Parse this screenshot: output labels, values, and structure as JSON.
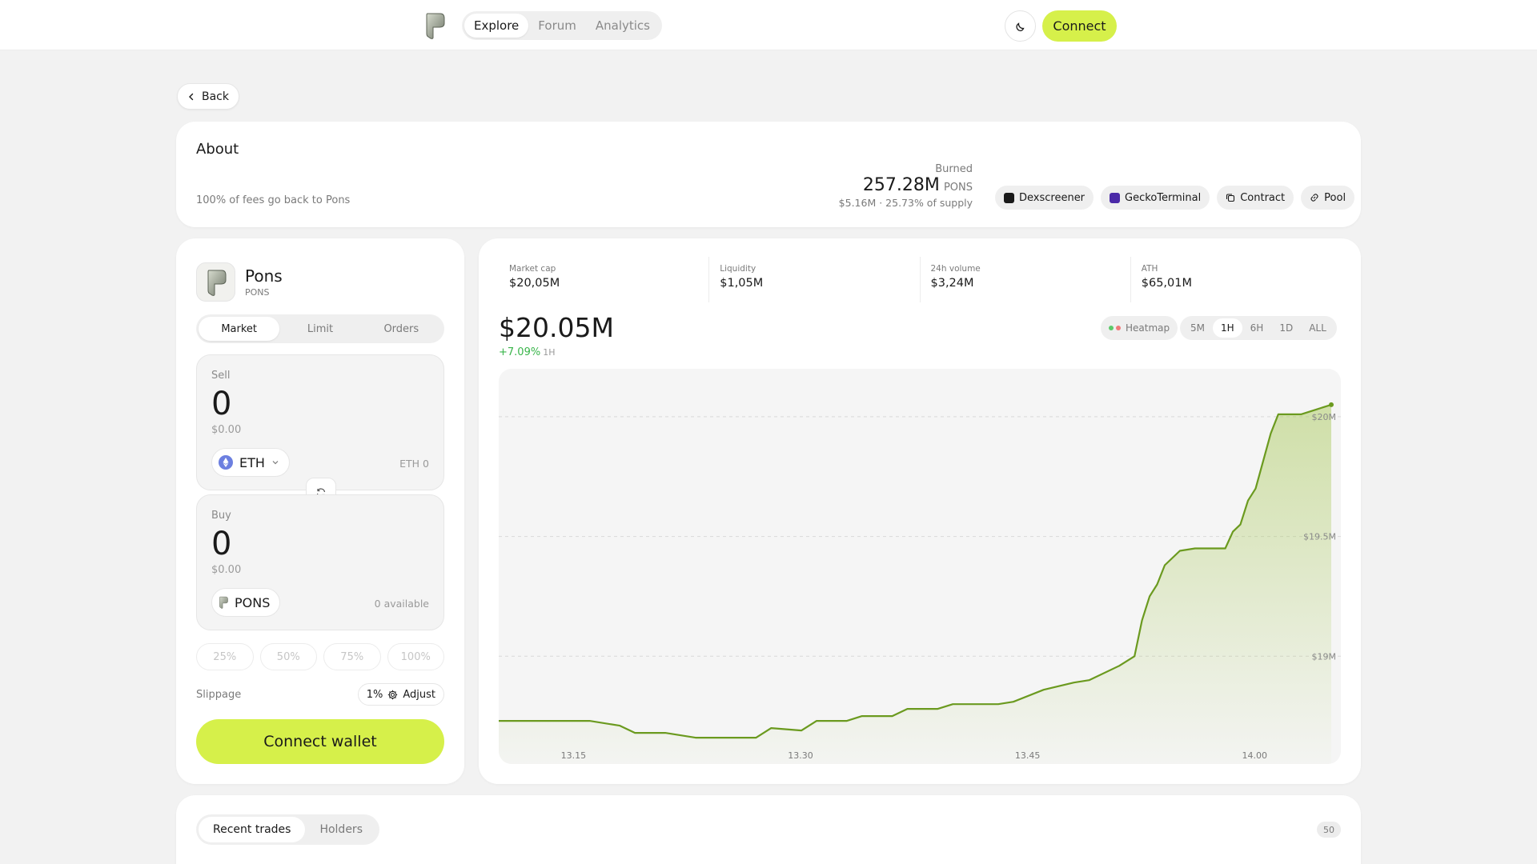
{
  "nav": {
    "tabs": [
      "Explore",
      "Forum",
      "Analytics"
    ],
    "connect_label": "Connect",
    "theme_icon": "moon-icon"
  },
  "back_label": "Back",
  "about": {
    "title": "About",
    "description": "100% of fees go back to Pons",
    "burned_label": "Burned",
    "burned_amount": "257.28M",
    "burned_unit": "PONS",
    "burned_sub": "$5.16M · 25.73% of supply",
    "links": [
      "Dexscreener",
      "GeckoTerminal",
      "Contract",
      "Pool"
    ]
  },
  "token": {
    "name": "Pons",
    "symbol": "PONS"
  },
  "trade": {
    "tabs": [
      "Market",
      "Limit",
      "Orders"
    ],
    "sell_label": "Sell",
    "sell_amount": "0",
    "sell_usd": "$0.00",
    "sell_token": "ETH",
    "sell_balance": "ETH 0",
    "buy_label": "Buy",
    "buy_amount": "0",
    "buy_usd": "$0.00",
    "buy_token": "PONS",
    "buy_balance": "0 available",
    "percentages": [
      "25%",
      "50%",
      "75%",
      "100%"
    ],
    "slippage_label": "Slippage",
    "slippage_value": "1%",
    "adjust_label": "Adjust",
    "wallet_button": "Connect wallet"
  },
  "stats": [
    {
      "label": "Market cap",
      "value": "$20,05M"
    },
    {
      "label": "Liquidity",
      "value": "$1,05M"
    },
    {
      "label": "24h volume",
      "value": "$3,24M"
    },
    {
      "label": "ATH",
      "value": "$65,01M"
    }
  ],
  "price": {
    "value": "$20.05M",
    "change": "+7.09%",
    "change_timeframe": "1H"
  },
  "chart_controls": {
    "heatmap_label": "Heatmap",
    "timeframes": [
      "5M",
      "1H",
      "6H",
      "1D",
      "ALL"
    ],
    "selected_timeframe": "1H"
  },
  "colors": {
    "accent": "#d6f04a",
    "line": "#6b9a1f",
    "positive": "#39b54a"
  },
  "chart_data": {
    "type": "area",
    "x_ticks": [
      "13.15",
      "13.30",
      "13.45",
      "14.00"
    ],
    "y_ticks": [
      "$20M",
      "$19.5M",
      "$19M"
    ],
    "ylim": [
      18.55,
      20.2
    ],
    "series": [
      {
        "points": [
          [
            "13.11",
            18.73
          ],
          [
            "13.14",
            18.73
          ],
          [
            "13.17",
            18.73
          ],
          [
            "13.19",
            18.71
          ],
          [
            "13.20",
            18.68
          ],
          [
            "13.22",
            18.68
          ],
          [
            "13.24",
            18.66
          ],
          [
            "13.26",
            18.66
          ],
          [
            "13.28",
            18.66
          ],
          [
            "13.29",
            18.7
          ],
          [
            "13.31",
            18.69
          ],
          [
            "13.32",
            18.73
          ],
          [
            "13.34",
            18.73
          ],
          [
            "13.35",
            18.75
          ],
          [
            "13.37",
            18.75
          ],
          [
            "13.38",
            18.78
          ],
          [
            "13.40",
            18.78
          ],
          [
            "13.41",
            18.8
          ],
          [
            "13.44",
            18.8
          ],
          [
            "13.45",
            18.81
          ],
          [
            "13.47",
            18.86
          ],
          [
            "13.49",
            18.89
          ],
          [
            "13.50",
            18.9
          ],
          [
            "13.52",
            18.96
          ],
          [
            "13.53",
            19.0
          ],
          [
            "13.535",
            19.15
          ],
          [
            "13.54",
            19.25
          ],
          [
            "13.545",
            19.3
          ],
          [
            "13.55",
            19.38
          ],
          [
            "13.56",
            19.44
          ],
          [
            "13.57",
            19.45
          ],
          [
            "13.59",
            19.45
          ],
          [
            "13.595",
            19.52
          ],
          [
            "14.00",
            19.55
          ],
          [
            "14.005",
            19.65
          ],
          [
            "14.01",
            19.7
          ],
          [
            "14.02",
            19.93
          ],
          [
            "14.025",
            20.01
          ],
          [
            "14.03",
            20.01
          ],
          [
            "14.04",
            20.01
          ],
          [
            "14.05",
            20.03
          ],
          [
            "14.06",
            20.05
          ]
        ]
      }
    ],
    "grid": true
  },
  "trades": {
    "tabs": [
      "Recent trades",
      "Holders"
    ],
    "count": "50"
  }
}
